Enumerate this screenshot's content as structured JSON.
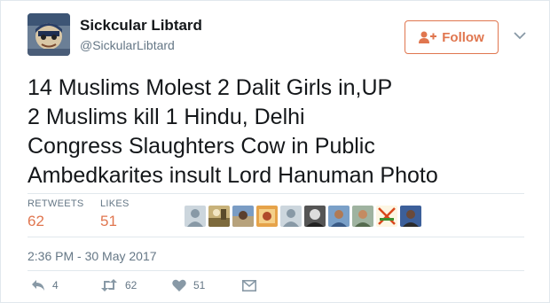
{
  "user": {
    "display_name": "Sickcular Libtard",
    "handle": "@SickularLibtard"
  },
  "follow_button": {
    "label": "Follow"
  },
  "tweet": {
    "lines": [
      "14 Muslims Molest 2 Dalit Girls in,UP",
      "2 Muslims kill 1 Hindu, Delhi",
      "Congress Slaughters Cow in Public",
      "Ambedkarites insult Lord Hanuman Photo"
    ]
  },
  "stats": {
    "retweets_label": "RETWEETS",
    "retweets_value": "62",
    "likes_label": "LIKES",
    "likes_value": "51"
  },
  "liker_avatars": [
    "default-avatar",
    "photo-avatar",
    "photo-avatar",
    "photo-avatar",
    "default-avatar",
    "photo-avatar",
    "photo-avatar",
    "photo-avatar",
    "crossed-out-avatar",
    "photo-avatar"
  ],
  "timestamp": "2:36 PM - 30 May 2017",
  "actions": {
    "reply_count": "4",
    "retweet_count": "62",
    "like_count": "51"
  },
  "colors": {
    "accent": "#e0764f",
    "text": "#14171a",
    "muted": "#657786",
    "icon": "#8899a6",
    "divider": "#e1e8ed"
  }
}
